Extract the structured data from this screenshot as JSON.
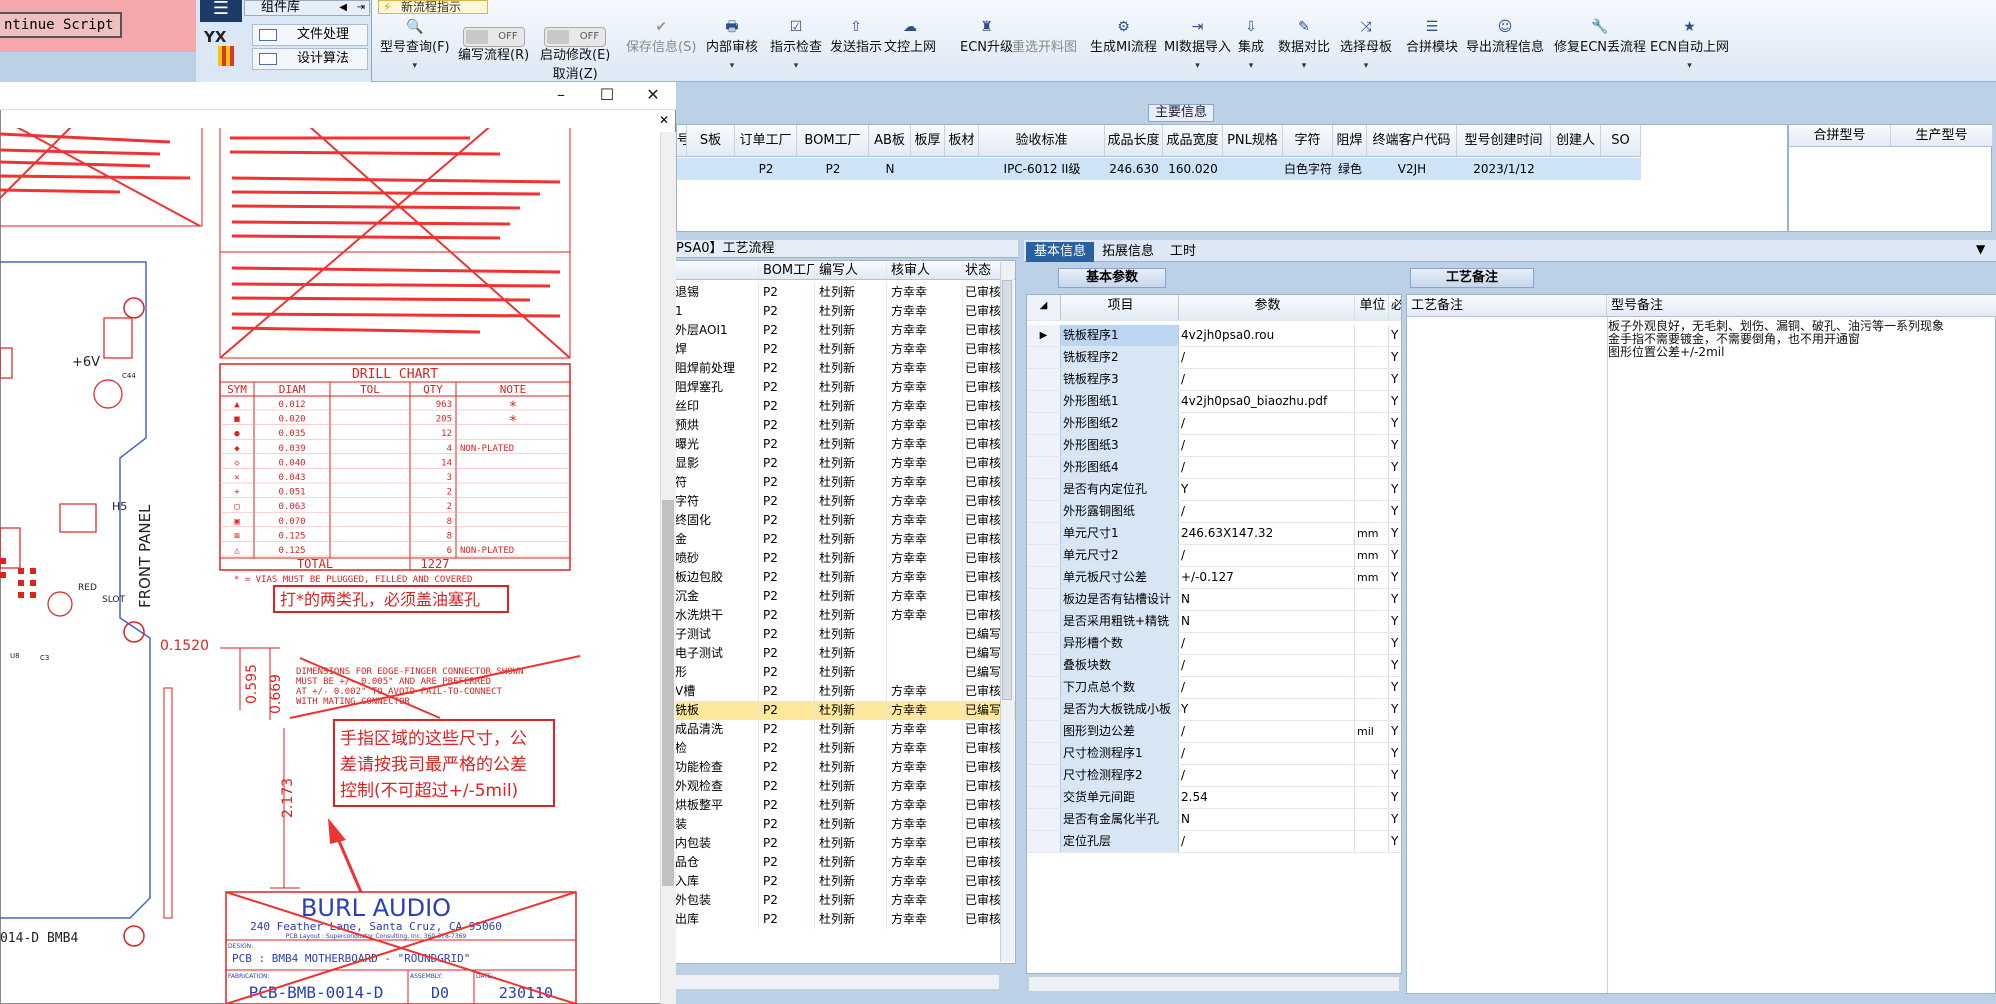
{
  "script_button": "ntinue Script",
  "component_panel": {
    "title": "组件库",
    "logo_text": "YX",
    "items": [
      "文件处理",
      "设计算法"
    ]
  },
  "flow_tab": "新流程指示",
  "toolbar": [
    {
      "label": "型号查询(F)",
      "icon": "🔍",
      "dropdown": true
    },
    {
      "label": "编写流程(R)",
      "toggle": "OFF"
    },
    {
      "label": "启动修改(E)",
      "sub": "取消(Z)",
      "toggle": "OFF"
    },
    {
      "label": "保存信息(S)",
      "icon": "✔",
      "disabled": true
    },
    {
      "label": "内部审核",
      "icon": "🖶",
      "dropdown": true
    },
    {
      "label": "指示检查",
      "icon": "☑",
      "dropdown": true
    },
    {
      "label": "发送指示",
      "icon": "⇧"
    },
    {
      "label": "文控上网",
      "icon": "☁"
    },
    {
      "label": "ECN升级",
      "icon": "♜"
    },
    {
      "label": "重选开料图",
      "icon": "",
      "disabled": true
    },
    {
      "label": "生成MI流程",
      "icon": "⚙"
    },
    {
      "label": "MI数据导入",
      "icon": "⇥",
      "dropdown": true
    },
    {
      "label": "集成",
      "icon": "⇩",
      "dropdown": true
    },
    {
      "label": "数据对比",
      "icon": "✎",
      "dropdown": true
    },
    {
      "label": "选择母板",
      "icon": "⤨",
      "dropdown": true
    },
    {
      "label": "合拼模块",
      "icon": "☰"
    },
    {
      "label": "导出流程信息",
      "icon": "☺"
    },
    {
      "label": "修复ECN丢流程",
      "icon": "🔧"
    },
    {
      "label": "ECN自动上网",
      "icon": "★",
      "dropdown": true
    }
  ],
  "main_info": {
    "title": "主要信息",
    "columns": [
      "号",
      "S板",
      "订单工厂",
      "BOM工厂",
      "AB板",
      "板厚",
      "板材",
      "验收标准",
      "成品长度",
      "成品宽度",
      "PNL规格",
      "字符",
      "阻焊",
      "终端客户代码",
      "型号创建时间",
      "创建人",
      "SO"
    ],
    "row": [
      "",
      "",
      "P2",
      "P2",
      "N",
      "",
      "",
      "IPC-6012 II级",
      "246.630",
      "160.020",
      "",
      "白色字符",
      "绿色",
      "V2JH",
      "2023/1/12",
      "",
      ""
    ],
    "merge_columns": [
      "合拼型号",
      "生产型号"
    ]
  },
  "process": {
    "caption": "PSA0】工艺流程",
    "columns": [
      "",
      "BOM工厂",
      "编写人",
      "核审人",
      "状态"
    ],
    "rows": [
      [
        "退锡",
        "P2",
        "杜列新",
        "方幸幸",
        "已审核"
      ],
      [
        "1",
        "P2",
        "杜列新",
        "方幸幸",
        "已审核"
      ],
      [
        "外层AOI1",
        "P2",
        "杜列新",
        "方幸幸",
        "已审核"
      ],
      [
        "焊",
        "P2",
        "杜列新",
        "方幸幸",
        "已审核"
      ],
      [
        "阻焊前处理",
        "P2",
        "杜列新",
        "方幸幸",
        "已审核"
      ],
      [
        "阻焊塞孔",
        "P2",
        "杜列新",
        "方幸幸",
        "已审核"
      ],
      [
        "丝印",
        "P2",
        "杜列新",
        "方幸幸",
        "已审核"
      ],
      [
        "预烘",
        "P2",
        "杜列新",
        "方幸幸",
        "已审核"
      ],
      [
        "曝光",
        "P2",
        "杜列新",
        "方幸幸",
        "已审核"
      ],
      [
        "显影",
        "P2",
        "杜列新",
        "方幸幸",
        "已审核"
      ],
      [
        "符",
        "P2",
        "杜列新",
        "方幸幸",
        "已审核"
      ],
      [
        "字符",
        "P2",
        "杜列新",
        "方幸幸",
        "已审核"
      ],
      [
        "终固化",
        "P2",
        "杜列新",
        "方幸幸",
        "已审核"
      ],
      [
        "金",
        "P2",
        "杜列新",
        "方幸幸",
        "已审核"
      ],
      [
        "喷砂",
        "P2",
        "杜列新",
        "方幸幸",
        "已审核"
      ],
      [
        "板边包胶",
        "P2",
        "杜列新",
        "方幸幸",
        "已审核"
      ],
      [
        "沉金",
        "P2",
        "杜列新",
        "方幸幸",
        "已审核"
      ],
      [
        "水洗烘干",
        "P2",
        "杜列新",
        "方幸幸",
        "已审核"
      ],
      [
        "子测试",
        "P2",
        "杜列新",
        "",
        "已编写"
      ],
      [
        "电子测试",
        "P2",
        "杜列新",
        "",
        "已编写"
      ],
      [
        "形",
        "P2",
        "杜列新",
        "",
        "已编写"
      ],
      [
        "V槽",
        "P2",
        "杜列新",
        "方幸幸",
        "已审核"
      ],
      [
        "铣板",
        "P2",
        "杜列新",
        "方幸幸",
        "已编写"
      ],
      [
        "成品清洗",
        "P2",
        "杜列新",
        "方幸幸",
        "已审核"
      ],
      [
        "检",
        "P2",
        "杜列新",
        "方幸幸",
        "已审核"
      ],
      [
        "功能检查",
        "P2",
        "杜列新",
        "方幸幸",
        "已审核"
      ],
      [
        "外观检查",
        "P2",
        "杜列新",
        "方幸幸",
        "已审核"
      ],
      [
        "烘板整平",
        "P2",
        "杜列新",
        "方幸幸",
        "已审核"
      ],
      [
        "装",
        "P2",
        "杜列新",
        "方幸幸",
        "已审核"
      ],
      [
        "内包装",
        "P2",
        "杜列新",
        "方幸幸",
        "已审核"
      ],
      [
        "品仓",
        "P2",
        "杜列新",
        "方幸幸",
        "已审核"
      ],
      [
        "入库",
        "P2",
        "杜列新",
        "方幸幸",
        "已审核"
      ],
      [
        "外包装",
        "P2",
        "杜列新",
        "方幸幸",
        "已审核"
      ],
      [
        "出库",
        "P2",
        "杜列新",
        "方幸幸",
        "已审核"
      ]
    ],
    "selected_index": 22
  },
  "tabs": [
    "基本信息",
    "拓展信息",
    "工时"
  ],
  "sub_tab": "基本参数",
  "params": {
    "columns": [
      "项目",
      "参数",
      "单位",
      "必"
    ],
    "rows": [
      [
        "铣板程序1",
        "4v2jh0psa0.rou",
        "",
        "Y"
      ],
      [
        "铣板程序2",
        "/",
        "",
        "Y"
      ],
      [
        "铣板程序3",
        "/",
        "",
        "Y"
      ],
      [
        "外形图纸1",
        "4v2jh0psa0_biaozhu.pdf",
        "",
        "Y"
      ],
      [
        "外形图纸2",
        "/",
        "",
        "Y"
      ],
      [
        "外形图纸3",
        "/",
        "",
        "Y"
      ],
      [
        "外形图纸4",
        "/",
        "",
        "Y"
      ],
      [
        "是否有内定位孔",
        "Y",
        "",
        "Y"
      ],
      [
        "外形露铜图纸",
        "/",
        "",
        "Y"
      ],
      [
        "单元尺寸1",
        "246.63X147.32",
        "mm",
        "Y"
      ],
      [
        "单元尺寸2",
        "/",
        "mm",
        "Y"
      ],
      [
        "单元板尺寸公差",
        "+/-0.127",
        "mm",
        "Y"
      ],
      [
        "板边是否有钻槽设计",
        "N",
        "",
        "Y"
      ],
      [
        "是否采用粗铣+精铣",
        "N",
        "",
        "Y"
      ],
      [
        "异形槽个数",
        "/",
        "",
        "Y"
      ],
      [
        "叠板块数",
        "/",
        "",
        "Y"
      ],
      [
        "下刀点总个数",
        "/",
        "",
        "Y"
      ],
      [
        "是否为大板铣成小板",
        "Y",
        "",
        "Y"
      ],
      [
        "图形到边公差",
        "/",
        "mil",
        "Y"
      ],
      [
        "尺寸检测程序1",
        "/",
        "",
        "Y"
      ],
      [
        "尺寸检测程序2",
        "/",
        "",
        "Y"
      ],
      [
        "交货单元间距",
        "2.54",
        "",
        "Y"
      ],
      [
        "是否有金属化半孔",
        "N",
        "",
        "Y"
      ],
      [
        "定位孔层",
        "/",
        "",
        "Y"
      ]
    ]
  },
  "notes": {
    "tab": "工艺备注",
    "columns": [
      "工艺备注",
      "型号备注"
    ],
    "model_note": [
      "板子外观良好，无毛刺、划伤、漏铜、破孔、油污等一系列现象",
      "金手指不需要镀金，不需要倒角，也不用开通窗",
      "图形位置公差+/-2mil"
    ]
  },
  "viewer": {
    "drill_chart": {
      "title": "DRILL CHART",
      "columns": [
        "SYM",
        "DIAM",
        "TOL",
        "QTY",
        "NOTE"
      ],
      "rows": [
        [
          "▲",
          "0.012",
          "",
          "963",
          "*"
        ],
        [
          "■",
          "0.020",
          "",
          "205",
          "*"
        ],
        [
          "●",
          "0.035",
          "",
          "12",
          ""
        ],
        [
          "◆",
          "0.039",
          "",
          "4",
          "NON-PLATED"
        ],
        [
          "◇",
          "0.040",
          "",
          "14",
          ""
        ],
        [
          "✕",
          "0.043",
          "",
          "3",
          ""
        ],
        [
          "+",
          "0.051",
          "",
          "2",
          ""
        ],
        [
          "▢",
          "0.063",
          "",
          "2",
          ""
        ],
        [
          "▣",
          "0.070",
          "",
          "8",
          ""
        ],
        [
          "⊠",
          "0.125",
          "",
          "8",
          ""
        ],
        [
          "△",
          "0.125",
          "",
          "6",
          "NON-PLATED"
        ]
      ],
      "total_label": "TOTAL",
      "total": "1227",
      "footnote": "* = VIAS MUST BE PLUGGED, FILLED AND COVERED"
    },
    "annotation_plug": "打*的两类孔，必须盖油塞孔",
    "annotation_finger": [
      "手指区域的这些尺寸，公",
      "差请按我司最严格的公差",
      "控制(不可超过+/-5mil)"
    ],
    "dim_labels": [
      "0.1520",
      "0.595",
      "0.669",
      "2.173"
    ],
    "edge_note": [
      "DIMENSIONS FOR EDGE-FINGER CONNECTOR SHOWN",
      "MUST BE +/- 0.005\" AND ARE PREFERRED",
      "AT +/- 0.002\" TO AVOID FAIL-TO-CONNECT",
      "WITH MATING CONNECTOR"
    ],
    "board_labels": [
      "+6V",
      "FRONT PANEL",
      "H5",
      "RED",
      "SLOT",
      "014-D BMB4",
      "C44",
      "U8",
      "C3"
    ],
    "title_block": {
      "company": "BURL AUDIO",
      "address": "240 Feather Lane, Santa Cruz, CA 95060",
      "layout": "PCB Layout : Superconductor Consulting, Inc. 360-378-7369",
      "design_label": "DESIGN:",
      "design": "PCB : BMB4 MOTHERBOARD - \"ROUNDGRID\"",
      "fab_label": "FABRICATION:",
      "fab": "PCB-BMB-0014-D",
      "assembly_label": "ASSEMBLY:",
      "assembly": "D0",
      "date_label": "DATE:",
      "date": "230110"
    }
  }
}
